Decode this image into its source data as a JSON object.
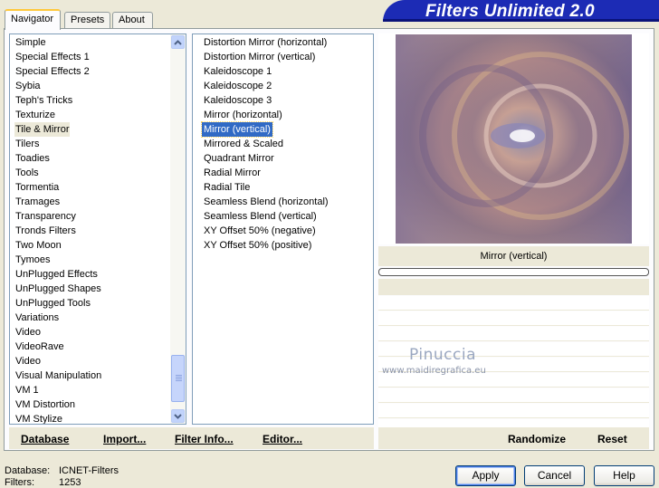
{
  "tabs": [
    "Navigator",
    "Presets",
    "About"
  ],
  "banner": {
    "title": "Filters Unlimited 2.0"
  },
  "categories": [
    "Simple",
    "Special Effects 1",
    "Special Effects 2",
    "Sybia",
    "Teph's Tricks",
    "Texturize",
    "Tile & Mirror",
    "Tilers",
    "Toadies",
    "Tools",
    "Tormentia",
    "Tramages",
    "Transparency",
    "Tronds Filters",
    "Two Moon",
    "Tymoes",
    "UnPlugged Effects",
    "UnPlugged Shapes",
    "UnPlugged Tools",
    "Variations",
    "Video",
    "VideoRave",
    "Video",
    "Visual Manipulation",
    "VM 1",
    "VM Distortion",
    "VM Stylize"
  ],
  "selected_category": "Tile & Mirror",
  "filters": [
    "Distortion Mirror (horizontal)",
    "Distortion Mirror (vertical)",
    "Kaleidoscope 1",
    "Kaleidoscope 2",
    "Kaleidoscope 3",
    "Mirror (horizontal)",
    "Mirror (vertical)",
    "Mirrored & Scaled",
    "Quadrant Mirror",
    "Radial Mirror",
    "Radial Tile",
    "Seamless Blend (horizontal)",
    "Seamless Blend (vertical)",
    "XY Offset 50% (negative)",
    "XY Offset 50% (positive)"
  ],
  "selected_filter": "Mirror (vertical)",
  "preview": {
    "filter_name": "Mirror (vertical)",
    "progress": 0
  },
  "watermark": {
    "name": "Pinuccia",
    "url": "www.maidiregrafica.eu"
  },
  "left_buttons": [
    "Database",
    "Import...",
    "Filter Info...",
    "Editor..."
  ],
  "right_buttons": [
    "Randomize",
    "Reset"
  ],
  "status": {
    "database_label": "Database:",
    "database_value": "ICNET-Filters",
    "filters_label": "Filters:",
    "filters_value": "1253"
  },
  "dialog_buttons": {
    "apply": "Apply",
    "cancel": "Cancel",
    "help": "Help"
  },
  "icons": {
    "scroll_up": "chevron-up-icon",
    "scroll_down": "chevron-down-icon"
  }
}
